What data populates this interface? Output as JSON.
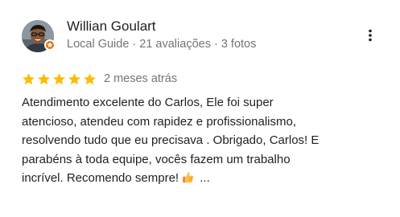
{
  "reviewer": {
    "name": "Willian Goulart",
    "meta": "Local Guide · 21 avaliações · 3 fotos",
    "avatar_icon": "profile-photo",
    "badge_icon": "local-guide-badge-icon"
  },
  "rating": {
    "stars": 5,
    "max_stars": 5,
    "star_color": "#fbbc04",
    "date": "2 meses atrás"
  },
  "review": {
    "lines": [
      "Atendimento excelente do Carlos, Ele foi super",
      "atencioso, atendeu com rapidez e profissionalismo,",
      "resolvendo tudo que eu precisava . Obrigado, Carlos! E",
      "parabéns à toda equipe, vocês fazem um trabalho",
      "incrível. Recomendo sempre!"
    ],
    "emoji_icon": "thumbs-up-emoji-icon",
    "ellipsis": "..."
  },
  "menu": {
    "icon": "more-vertical-icon"
  }
}
